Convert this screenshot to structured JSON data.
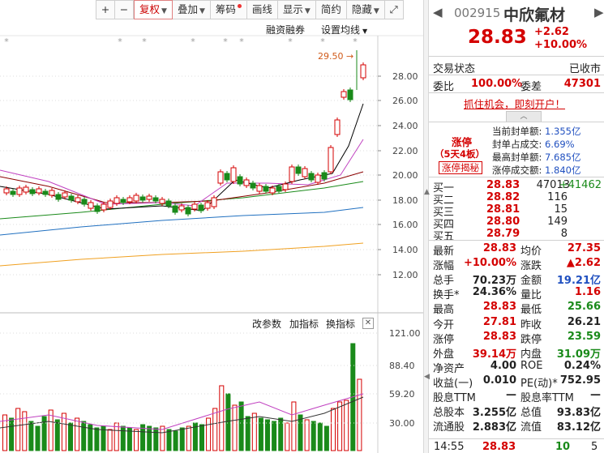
{
  "toolbar": {
    "plus": "+",
    "minus": "−",
    "fq": "复权",
    "diejia": "叠加",
    "choumai": "筹码",
    "huaxian": "画线",
    "xianshi": "显示",
    "jianyue": "简约",
    "yincang": "隐藏"
  },
  "chart_header": {
    "rzrq": "融资融券",
    "setma": "设置均线"
  },
  "price_axis": [
    "28.00",
    "26.00",
    "24.00",
    "22.00",
    "20.00",
    "18.00",
    "16.00",
    "14.00",
    "12.00"
  ],
  "max_price_label": "29.50",
  "sub_toolbar": {
    "params": "改参数",
    "add": "加指标",
    "switch": "换指标"
  },
  "vol_axis": [
    "121.00",
    "88.40",
    "59.20",
    "30.00"
  ],
  "stock": {
    "code": "002915",
    "name": "中欣氟材",
    "price": "28.83",
    "change": "+2.62",
    "pct": "+10.00%"
  },
  "status": {
    "label": "交易状态",
    "value": "已收市",
    "weibi_label": "委比",
    "weibi": "100.00%",
    "weicha_label": "委差",
    "weicha": "47301"
  },
  "promo": "抓住机会，即刻开户！",
  "limit": {
    "title": "涨停",
    "days": "（5天4板）",
    "reveal": "涨停揭秘",
    "rows": [
      {
        "label": "当前封单额:",
        "value": "1.355亿"
      },
      {
        "label": "封单占成交:",
        "value": "6.69%"
      },
      {
        "label": "最高封单额:",
        "value": "7.685亿"
      },
      {
        "label": "涨停成交额:",
        "value": "1.840亿"
      }
    ]
  },
  "bids": [
    {
      "label": "买一",
      "price": "28.83",
      "vol": "47013",
      "extra": "+41462"
    },
    {
      "label": "买二",
      "price": "28.82",
      "vol": "116",
      "extra": ""
    },
    {
      "label": "买三",
      "price": "28.81",
      "vol": "15",
      "extra": ""
    },
    {
      "label": "买四",
      "price": "28.80",
      "vol": "149",
      "extra": ""
    },
    {
      "label": "买五",
      "price": "28.79",
      "vol": "8",
      "extra": ""
    }
  ],
  "stats": [
    {
      "l1": "最新",
      "v1": "28.83",
      "c1": "red",
      "l2": "均价",
      "v2": "27.35",
      "c2": "red"
    },
    {
      "l1": "涨幅",
      "v1": "+10.00%",
      "c1": "red",
      "l2": "涨跌",
      "v2": "▲2.62",
      "c2": "red"
    },
    {
      "l1": "总手",
      "v1": "70.23万",
      "c1": "",
      "l2": "金额",
      "v2": "19.21亿",
      "c2": "blue"
    },
    {
      "l1": "换手*",
      "v1": "24.36%",
      "c1": "",
      "l2": "量比",
      "v2": "1.16",
      "c2": "red"
    },
    {
      "l1": "最高",
      "v1": "28.83",
      "c1": "red",
      "l2": "最低",
      "v2": "25.66",
      "c2": "green"
    },
    {
      "l1": "今开",
      "v1": "27.81",
      "c1": "red",
      "l2": "昨收",
      "v2": "26.21",
      "c2": ""
    },
    {
      "l1": "涨停",
      "v1": "28.83",
      "c1": "red",
      "l2": "跌停",
      "v2": "23.59",
      "c2": "green"
    },
    {
      "l1": "外盘",
      "v1": "39.14万",
      "c1": "red",
      "l2": "内盘",
      "v2": "31.09万",
      "c2": "green"
    },
    {
      "l1": "净资产",
      "v1": "4.00",
      "c1": "",
      "l2": "ROE",
      "v2": "0.24%",
      "c2": ""
    },
    {
      "l1": "收益(一)",
      "v1": "0.010",
      "c1": "",
      "l2": "PE(动)*",
      "v2": "752.95",
      "c2": ""
    },
    {
      "l1": "股息TTM",
      "v1": "—",
      "c1": "",
      "l2": "股息率TTM",
      "v2": "—",
      "c2": ""
    },
    {
      "l1": "总股本",
      "v1": "3.255亿",
      "c1": "",
      "l2": "总值",
      "v2": "93.83亿",
      "c2": ""
    },
    {
      "l1": "流通股",
      "v1": "2.883亿",
      "c1": "",
      "l2": "流值",
      "v2": "83.12亿",
      "c2": ""
    }
  ],
  "tick": {
    "time": "14:55",
    "price": "28.83",
    "vol": "10",
    "n": "5"
  },
  "colors": {
    "up": "#d40000",
    "down": "#1a8a1a",
    "blue": "#2050c0",
    "accent_promo": "#d40000"
  }
}
